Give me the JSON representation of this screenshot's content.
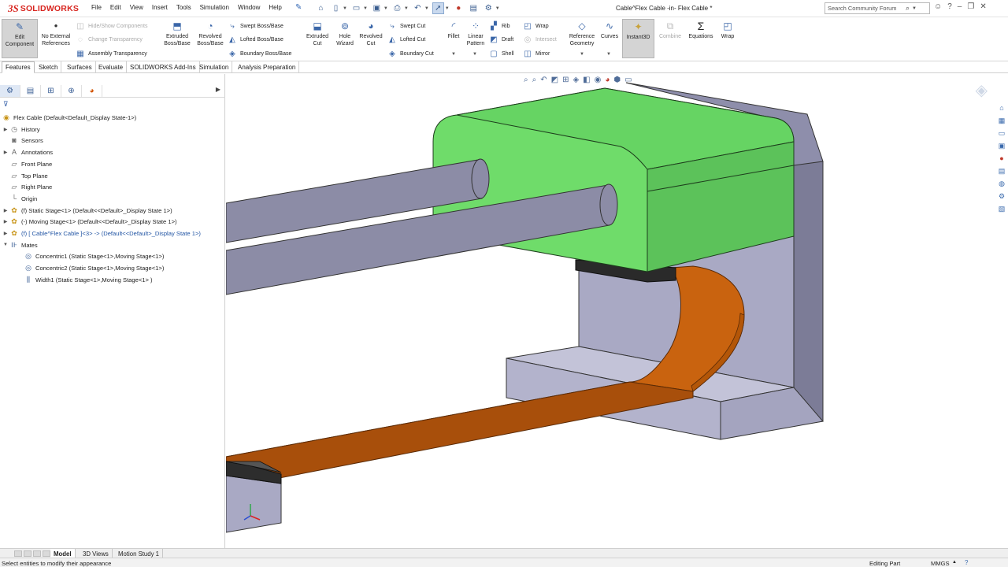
{
  "app": {
    "brand_ds": "3S",
    "brand_name": "SOLIDWORKS",
    "document_title": "Cable^Flex Cable -in- Flex Cable *"
  },
  "menu": [
    "File",
    "Edit",
    "View",
    "Insert",
    "Tools",
    "Simulation",
    "Window",
    "Help"
  ],
  "search": {
    "placeholder": "Search Community Forum"
  },
  "command_manager": {
    "edit_component": "Edit Component",
    "no_external_refs": "No External References",
    "hide_show": "Hide/Show Components",
    "change_transparency": "Change Transparency",
    "assembly_transparency": "Assembly Transparency",
    "extruded_boss": "Extruded Boss/Base",
    "revolved_boss": "Revolved Boss/Base",
    "swept_boss": "Swept Boss/Base",
    "lofted_boss": "Lofted Boss/Base",
    "boundary_boss": "Boundary Boss/Base",
    "extruded_cut": "Extruded Cut",
    "hole_wizard": "Hole Wizard",
    "revolved_cut": "Revolved Cut",
    "swept_cut": "Swept Cut",
    "lofted_cut": "Lofted Cut",
    "boundary_cut": "Boundary Cut",
    "fillet": "Fillet",
    "linear_pattern": "Linear Pattern",
    "rib": "Rib",
    "draft": "Draft",
    "shell": "Shell",
    "wrap_small": "Wrap",
    "intersect": "Intersect",
    "mirror": "Mirror",
    "reference_geometry": "Reference Geometry",
    "curves": "Curves",
    "instant3d": "Instant3D",
    "combine": "Combine",
    "equations": "Equations",
    "wrap": "Wrap"
  },
  "tabs": [
    "Features",
    "Sketch",
    "Surfaces",
    "Evaluate",
    "SOLIDWORKS Add-Ins",
    "Simulation",
    "Analysis Preparation"
  ],
  "feature_tree": {
    "root": "Flex Cable  (Default<Default_Display State-1>)",
    "history": "History",
    "sensors": "Sensors",
    "annotations": "Annotations",
    "front_plane": "Front Plane",
    "top_plane": "Top Plane",
    "right_plane": "Right Plane",
    "origin": "Origin",
    "static_stage": "(f) Static Stage<1> (Default<<Default>_Display State 1>)",
    "moving_stage": "(-) Moving Stage<1> (Default<<Default>_Display State 1>)",
    "cable": "(f) [ Cable^Flex Cable ]<3> -> (Default<<Default>_Display State 1>)",
    "mates": "Mates",
    "concentric1": "Concentric1 (Static Stage<1>,Moving Stage<1>)",
    "concentric2": "Concentric2 (Static Stage<1>,Moving Stage<1>)",
    "width1": "Width1 (Static Stage<1>,Moving Stage<1> )"
  },
  "bottom_tabs": [
    "Model",
    "3D Views",
    "Motion Study 1"
  ],
  "status": {
    "message": "Select entities to modify their appearance",
    "mode": "Editing Part",
    "units": "MMGS"
  },
  "colors": {
    "moving_stage": "#6fdc6a",
    "static_stage": "#a9a9c4",
    "rods": "#8c8ca6",
    "cable": "#c9630f",
    "brand": "#d8251f"
  }
}
